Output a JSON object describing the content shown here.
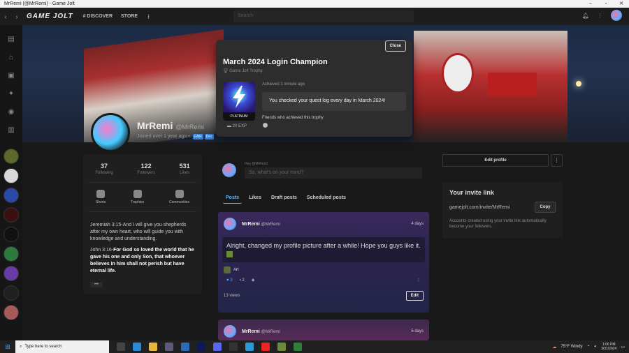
{
  "window": {
    "title": "MrRemi (@MrRemi) - Game Jolt",
    "controls": [
      "–",
      "▫",
      "✕"
    ]
  },
  "topnav": {
    "logo": "GAME JOLT",
    "discover": "# DISCOVER",
    "store": "STORE",
    "more": "⋮",
    "search_placeholder": "Search"
  },
  "profile": {
    "name": "MrRemi",
    "handle": "@MrRemi",
    "joined": "Joined over 1 year ago",
    "badges": [
      "GNR",
      "Dev"
    ],
    "stats": [
      {
        "num": "37",
        "label": "Following"
      },
      {
        "num": "122",
        "label": "Followers"
      },
      {
        "num": "531",
        "label": "Likes"
      }
    ],
    "shortcuts": [
      "Shorts",
      "Trophies",
      "Communities"
    ],
    "bio1": "Jeremiah 3:15-And I will give you shepherds after my own heart, who will guide you with knowledge and understanding.",
    "bio2_prefix": "John 3:16-",
    "bio2_bold": "For God so loved the world that he gave his one and only Son, that whoever believes in him shall not perish but have eternal life.",
    "more": "•••"
  },
  "composer": {
    "who": "Hey @MrRemi",
    "placeholder": "So, what's on your mind?"
  },
  "tabs": [
    "Posts",
    "Likes",
    "Draft posts",
    "Scheduled posts"
  ],
  "post1": {
    "name": "MrRemi",
    "handle": "@MrRemi",
    "time": "4 days",
    "body": "Alright, changed my profile picture after a while! Hope you guys like it.",
    "tag": "Art",
    "likes": "3",
    "comments": "2",
    "views": "13 views",
    "edit": "Edit"
  },
  "post2": {
    "name": "MrRemi",
    "handle": "@MrRemi",
    "time": "5 days"
  },
  "right": {
    "edit_profile": "Edit profile",
    "kebab": "⋮",
    "invite_title": "Your invite link",
    "invite_link": "gamejolt.com/invite/MrRemi",
    "copy": "Copy",
    "invite_note": "Accounts created using your invite link automatically become your followers."
  },
  "modal": {
    "close": "Close",
    "title": "March 2024 Login Champion",
    "sub": "Game Jolt Trophy",
    "platinum": "PLATINUM",
    "exp": "20 EXP",
    "achieved": "Achieved 1 minute ago",
    "quote": "You checked your quest log every day in March 2024!",
    "friends": "Friends who achieved this trophy"
  },
  "taskbar": {
    "search": "Type here to search",
    "weather": "75°F  Windy",
    "time": "1:06 PM",
    "date": "3/31/2024"
  }
}
